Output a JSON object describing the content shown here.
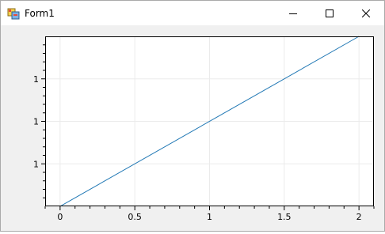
{
  "window": {
    "title": "Form1",
    "controls": {
      "minimize_icon": "minimize-icon",
      "maximize_icon": "maximize-icon",
      "close_icon": "close-icon"
    }
  },
  "colors": {
    "line": "#1f77b4",
    "grid": "#ebebeb",
    "client_bg": "#f0f0f0",
    "plot_bg": "#ffffff"
  },
  "chart_data": {
    "type": "line",
    "title": "",
    "xlabel": "",
    "ylabel": "",
    "xlim": [
      -0.1,
      2.1
    ],
    "ylim": [
      0,
      2
    ],
    "x_ticks": [
      0,
      0.5,
      1,
      1.5,
      2
    ],
    "x_tick_labels": [
      "0",
      "0.5",
      "1",
      "1.5",
      "2"
    ],
    "y_ticks": [
      0.5,
      1,
      1.5
    ],
    "y_tick_labels": [
      "1",
      "1",
      "1"
    ],
    "grid": true,
    "series": [
      {
        "x": [
          0,
          2
        ],
        "y": [
          0,
          2
        ]
      }
    ]
  }
}
